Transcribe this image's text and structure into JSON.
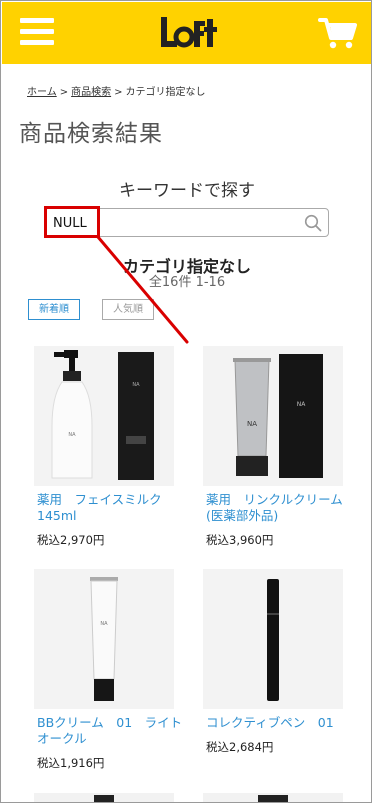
{
  "header": {
    "menu_icon": "hamburger-menu-icon",
    "logo_text": "LoFt",
    "cart_icon": "shopping-cart-icon",
    "brand_color": "#ffd200"
  },
  "breadcrumb": {
    "home": "ホーム",
    "sep1": ">",
    "search": "商品検索",
    "sep2": ">",
    "current": "カテゴリ指定なし"
  },
  "page_title": "商品検索結果",
  "search": {
    "title": "キーワードで探す",
    "value": "NULL",
    "icon": "search-icon"
  },
  "results": {
    "category": "カテゴリ指定なし",
    "count": "全16件 1-16"
  },
  "sort": {
    "new": "新着順",
    "popular": "人気順"
  },
  "products": [
    {
      "name": "薬用　フェイスミルク 145ml",
      "price": "税込2,970円"
    },
    {
      "name": "薬用　リンクルクリーム(医薬部外品)",
      "price": "税込3,960円"
    },
    {
      "name": "BBクリーム　01　ライトオークル",
      "price": "税込1,916円"
    },
    {
      "name": "コレクティブペン　01",
      "price": "税込2,684円"
    }
  ],
  "annotation_color": "#d90000",
  "link_color": "#2e8fd0"
}
